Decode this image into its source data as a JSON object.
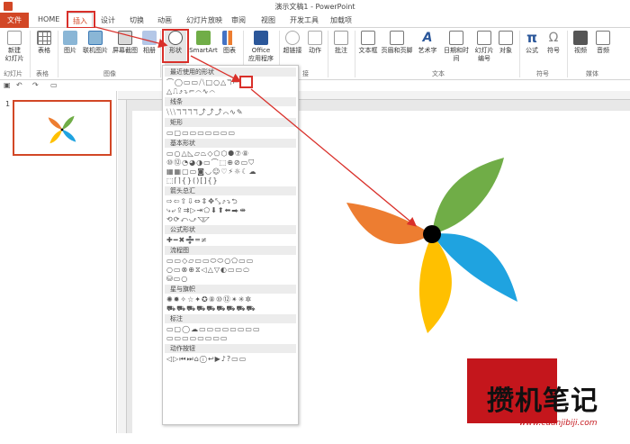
{
  "window": {
    "title": "演示文稿1 - PowerPoint"
  },
  "tabs": [
    {
      "label": "文件"
    },
    {
      "label": "HOME"
    },
    {
      "label": "插入"
    },
    {
      "label": "设计"
    },
    {
      "label": "切换"
    },
    {
      "label": "动画"
    },
    {
      "label": "幻灯片放映"
    },
    {
      "label": "审阅"
    },
    {
      "label": "视图"
    },
    {
      "label": "开发工具"
    },
    {
      "label": "加载项"
    }
  ],
  "ribbon": {
    "new_slide": "新建\n幻灯片",
    "table": "表格",
    "picture": "图片",
    "online_picture": "联机图片",
    "screenshot": "屏幕截图",
    "album": "相册",
    "shapes": "形状",
    "smartart": "SmartArt",
    "chart": "图表",
    "office_apps": "Office\n应用程序",
    "hyperlink": "超链接",
    "action": "动作",
    "comment": "批注",
    "textbox": "文本框",
    "header_footer": "页眉和页脚",
    "wordart": "艺术字",
    "datetime": "日期和时间",
    "slide_number": "幻灯片\n编号",
    "object": "对象",
    "equation": "公式",
    "symbol": "符号",
    "video": "视频",
    "audio": "音频",
    "groups": {
      "slides": "幻灯片",
      "tables": "表格",
      "images": "图像",
      "links": "接",
      "text": "文本",
      "symbols": "符号",
      "media": "媒体"
    }
  },
  "slides_panel": {
    "slide_number": "1"
  },
  "shapes_menu": {
    "sections": [
      {
        "label": "最近使用的形状"
      },
      {
        "label": "线条"
      },
      {
        "label": "矩形"
      },
      {
        "label": "基本形状"
      },
      {
        "label": "箭头总汇"
      },
      {
        "label": "公式形状"
      },
      {
        "label": "流程图"
      },
      {
        "label": "星与旗帜"
      },
      {
        "label": "标注"
      },
      {
        "label": "动作按钮"
      }
    ]
  },
  "pinwheel": {
    "colors": {
      "green": "#70ad47",
      "blue": "#1fa3e0",
      "yellow": "#ffc000",
      "orange": "#ed7d31",
      "center": "#000000"
    }
  },
  "watermark": {
    "text": "攒机笔记",
    "url": "www.cuanjibiji.com"
  }
}
